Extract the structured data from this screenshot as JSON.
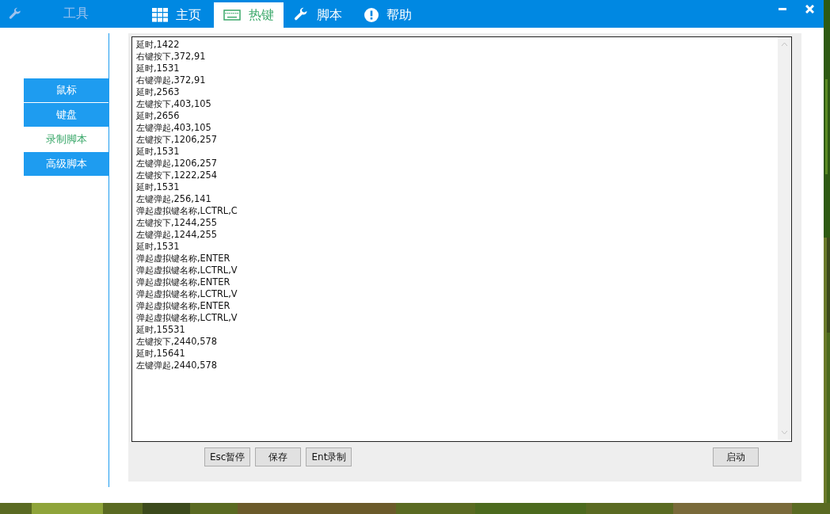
{
  "app": {
    "title": "工具"
  },
  "tabs": [
    {
      "label": "主页",
      "kind": "grid",
      "selected": false
    },
    {
      "label": "热键",
      "kind": "keyboard",
      "selected": true
    },
    {
      "label": "脚本",
      "kind": "wrench",
      "selected": false
    },
    {
      "label": "帮助",
      "kind": "info",
      "selected": false
    }
  ],
  "sidebar": {
    "items": [
      {
        "label": "鼠标",
        "selected": false
      },
      {
        "label": "键盘",
        "selected": false
      },
      {
        "label": "录制脚本",
        "selected": true
      },
      {
        "label": "高级脚本",
        "selected": false
      }
    ]
  },
  "script_lines": [
    "延时,1422",
    "右键按下,372,91",
    "延时,1531",
    "右键弹起,372,91",
    "延时,2563",
    "左键按下,403,105",
    "延时,2656",
    "左键弹起,403,105",
    "左键按下,1206,257",
    "延时,1531",
    "左键弹起,1206,257",
    "左键按下,1222,254",
    "延时,1531",
    "左键弹起,256,141",
    "弹起虚拟键名称,LCTRL,C",
    "左键按下,1244,255",
    "左键弹起,1244,255",
    "延时,1531",
    "弹起虚拟键名称,ENTER",
    "弹起虚拟键名称,LCTRL,V",
    "弹起虚拟键名称,ENTER",
    "弹起虚拟键名称,LCTRL,V",
    "弹起虚拟键名称,ENTER",
    "弹起虚拟键名称,LCTRL,V",
    "延时,15531",
    "左键按下,2440,578",
    "延时,15641",
    "左键弹起,2440,578"
  ],
  "buttons": [
    "Esc暂停",
    "保存",
    "Ent录制"
  ],
  "start_button": "启动"
}
